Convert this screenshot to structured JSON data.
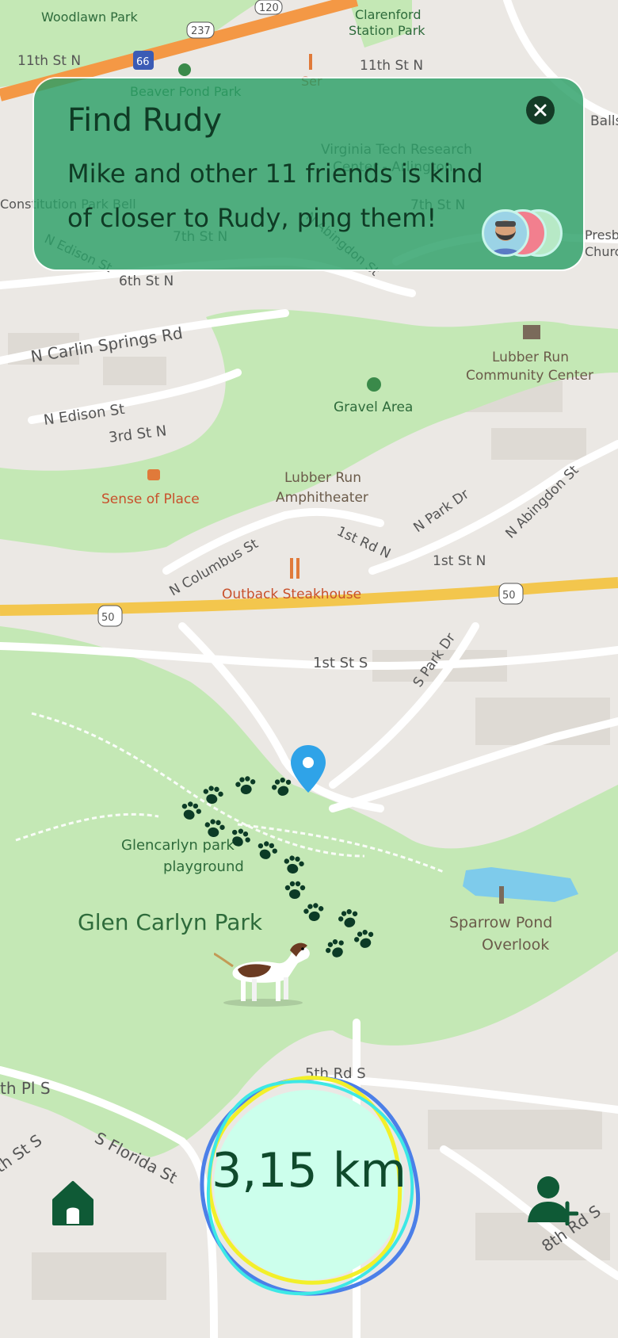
{
  "card": {
    "title": "Find Rudy",
    "message": "Mike and other 11 friends is kind of closer to Rudy, ping them!",
    "close_icon": "close-icon",
    "avatars": [
      "friend-avatar-bearded-man",
      "friend-avatar-red",
      "friend-avatar-green"
    ]
  },
  "distance": {
    "value": "3,15 km"
  },
  "nav": {
    "home_icon": "home-icon",
    "add_user_icon": "add-user-icon"
  },
  "colors": {
    "card": "#2ca068",
    "text_dark": "#0f3b25",
    "distance_fill": "#ccffec",
    "ring_blue": "#4b7fe8",
    "ring_yellow": "#f2f02a",
    "ring_cyan": "#3de8e6",
    "pin_blue": "#2fa3e8",
    "park_green": "#bfe6b0",
    "highway_yellow": "#f3c64d",
    "interstate_orange": "#f49845"
  },
  "map": {
    "labels": [
      "Woodlawn Park",
      "120",
      "237",
      "Clarenford",
      "Station Park",
      "11th St N",
      "11th St N",
      "66",
      "Beaver Pond Park",
      "Ser",
      "Balls",
      "Virginia Tech Research",
      "Center - Arlington",
      "Constitution Park Bell",
      "7th St N",
      "7th St N",
      "N Abingdon St",
      "N Edison St",
      "6th St N",
      "Presbyte",
      "Church",
      "N Carlin Springs Rd",
      "Lubber Run",
      "Community Center",
      "N Edison St",
      "Gravel Area",
      "3rd St N",
      "Lubber Run",
      "Amphitheater",
      "Sense of Place",
      "N Park Dr",
      "N Abingdon St",
      "1st Rd N",
      "N Columbus St",
      "1st St N",
      "Outback Steakhouse",
      "50",
      "50",
      "1st St S",
      "S Park Dr",
      "Glencarlyn park",
      "playground",
      "Glen Carlyn Park",
      "Sparrow Pond",
      "Overlook",
      "5th Rd S",
      "th Pl S",
      "S Florida St",
      "th St S",
      "8th Rd S"
    ]
  }
}
